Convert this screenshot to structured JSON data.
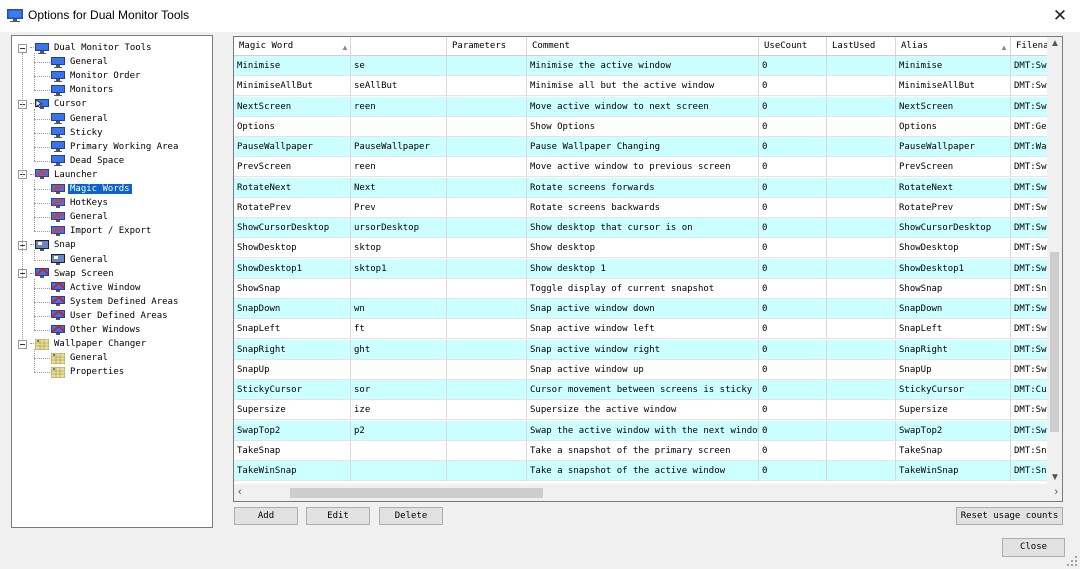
{
  "window": {
    "title": "Options for Dual Monitor Tools"
  },
  "tree": [
    {
      "label": "Dual Monitor Tools",
      "level": 0,
      "expander": true,
      "icon": "monitor-icon"
    },
    {
      "label": "General",
      "level": 1,
      "icon": "monitor-icon"
    },
    {
      "label": "Monitor Order",
      "level": 1,
      "icon": "monitor-icon"
    },
    {
      "label": "Monitors",
      "level": 1,
      "icon": "monitor-icon"
    },
    {
      "label": "Cursor",
      "level": 0,
      "expander": true,
      "icon": "cursor-icon"
    },
    {
      "label": "General",
      "level": 1,
      "icon": "monitor-icon"
    },
    {
      "label": "Sticky",
      "level": 1,
      "icon": "monitor-icon"
    },
    {
      "label": "Primary Working Area",
      "level": 1,
      "icon": "monitor-icon"
    },
    {
      "label": "Dead Space",
      "level": 1,
      "icon": "monitor-icon"
    },
    {
      "label": "Launcher",
      "level": 0,
      "expander": true,
      "icon": "launcher-icon"
    },
    {
      "label": "Magic Words",
      "level": 1,
      "icon": "launcher-icon",
      "selected": true
    },
    {
      "label": "HotKeys",
      "level": 1,
      "icon": "launcher-icon"
    },
    {
      "label": "General",
      "level": 1,
      "icon": "launcher-icon"
    },
    {
      "label": "Import / Export",
      "level": 1,
      "icon": "launcher-icon"
    },
    {
      "label": "Snap",
      "level": 0,
      "expander": true,
      "icon": "snap-icon"
    },
    {
      "label": "General",
      "level": 1,
      "icon": "snap-icon"
    },
    {
      "label": "Swap Screen",
      "level": 0,
      "expander": true,
      "icon": "swap-icon"
    },
    {
      "label": "Active Window",
      "level": 1,
      "icon": "swap-icon"
    },
    {
      "label": "System Defined Areas",
      "level": 1,
      "icon": "swap-icon"
    },
    {
      "label": "User Defined Areas",
      "level": 1,
      "icon": "swap-icon"
    },
    {
      "label": "Other Windows",
      "level": 1,
      "icon": "swap-icon"
    },
    {
      "label": "Wallpaper Changer",
      "level": 0,
      "expander": true,
      "icon": "wallpaper-icon"
    },
    {
      "label": "General",
      "level": 1,
      "icon": "wallpaper-icon"
    },
    {
      "label": "Properties",
      "level": 1,
      "icon": "wallpaper-icon"
    }
  ],
  "table": {
    "columns": [
      "Magic Word",
      "",
      "Parameters",
      "Comment",
      "UseCount",
      "LastUsed",
      "Alias",
      "Filena"
    ],
    "rows": [
      [
        "Minimise",
        "se",
        "",
        "Minimise the active window",
        "0",
        "",
        "Minimise",
        "DMT:Sw"
      ],
      [
        "MinimiseAllBut",
        "seAllBut",
        "",
        "Minimise all but the active window",
        "0",
        "",
        "MinimiseAllBut",
        "DMT:Sw"
      ],
      [
        "NextScreen",
        "reen",
        "",
        "Move active window to next screen",
        "0",
        "",
        "NextScreen",
        "DMT:Sw"
      ],
      [
        "Options",
        "",
        "",
        "Show Options",
        "0",
        "",
        "Options",
        "DMT:Ge"
      ],
      [
        "PauseWallpaper",
        "PauseWallpaper",
        "",
        "Pause Wallpaper Changing",
        "0",
        "",
        "PauseWallpaper",
        "DMT:Wa"
      ],
      [
        "PrevScreen",
        "reen",
        "",
        "Move active window to previous screen",
        "0",
        "",
        "PrevScreen",
        "DMT:Sw"
      ],
      [
        "RotateNext",
        "Next",
        "",
        "Rotate screens forwards",
        "0",
        "",
        "RotateNext",
        "DMT:Sw"
      ],
      [
        "RotatePrev",
        "Prev",
        "",
        "Rotate screens backwards",
        "0",
        "",
        "RotatePrev",
        "DMT:Sw"
      ],
      [
        "ShowCursorDesktop",
        "ursorDesktop",
        "",
        "Show desktop that cursor is on",
        "0",
        "",
        "ShowCursorDesktop",
        "DMT:Sw"
      ],
      [
        "ShowDesktop",
        "sktop",
        "",
        "Show desktop",
        "0",
        "",
        "ShowDesktop",
        "DMT:Sw"
      ],
      [
        "ShowDesktop1",
        "sktop1",
        "",
        "Show desktop 1",
        "0",
        "",
        "ShowDesktop1",
        "DMT:Sw"
      ],
      [
        "ShowSnap",
        "",
        "",
        "Toggle display of current snapshot",
        "0",
        "",
        "ShowSnap",
        "DMT:Sn"
      ],
      [
        "SnapDown",
        "wn",
        "",
        "Snap active window down",
        "0",
        "",
        "SnapDown",
        "DMT:Sw"
      ],
      [
        "SnapLeft",
        "ft",
        "",
        "Snap active window left",
        "0",
        "",
        "SnapLeft",
        "DMT:Sw"
      ],
      [
        "SnapRight",
        "ght",
        "",
        "Snap active window right",
        "0",
        "",
        "SnapRight",
        "DMT:Sw"
      ],
      [
        "SnapUp",
        "",
        "",
        "Snap active window up",
        "0",
        "",
        "SnapUp",
        "DMT:Sw"
      ],
      [
        "StickyCursor",
        "sor",
        "",
        "Cursor movement between screens is sticky",
        "0",
        "",
        "StickyCursor",
        "DMT:Cu"
      ],
      [
        "Supersize",
        "ize",
        "",
        "Supersize the active window",
        "0",
        "",
        "Supersize",
        "DMT:Sw"
      ],
      [
        "SwapTop2",
        "p2",
        "",
        "Swap the active window with the next window",
        "0",
        "",
        "SwapTop2",
        "DMT:Sw"
      ],
      [
        "TakeSnap",
        "",
        "",
        "Take a snapshot of the primary screen",
        "0",
        "",
        "TakeSnap",
        "DMT:Sn"
      ],
      [
        "TakeWinSnap",
        "",
        "",
        "Take a snapshot of the active window",
        "0",
        "",
        "TakeWinSnap",
        "DMT:Sn"
      ]
    ]
  },
  "buttons": {
    "add": "Add",
    "edit": "Edit",
    "delete": "Delete",
    "reset": "Reset usage counts",
    "close": "Close"
  },
  "colors": {
    "alt_row": "#ccffff",
    "selection": "#0a63ce"
  }
}
